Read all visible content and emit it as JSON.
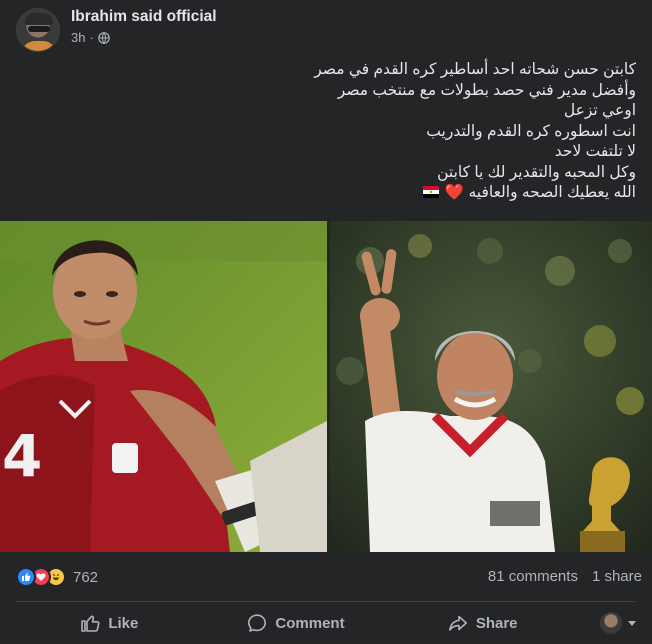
{
  "post": {
    "author": "Ibrahim said official",
    "time": "3h",
    "separator": "·",
    "privacy_icon": "globe-icon",
    "text_lines": [
      "كابتن حسن شحاته احد أساطير كره القدم في مصر",
      "وأفضل مدير فني حصد بطولات مع منتخب مصر",
      "اوعي تزعل",
      "انت اسطوره كره القدم والتدريب",
      "لا تلتفت لاحد",
      "وكل المحبه والتقدير لك يا كابتن",
      "الله يعطيك الصحه والعافيه"
    ],
    "last_line_emojis": "❤️",
    "images": {
      "left": "player-in-red-jersey-photo",
      "right": "coach-victory-sign-photo"
    }
  },
  "reactions": {
    "icons": [
      "like-reaction-icon",
      "love-reaction-icon",
      "haha-reaction-icon"
    ],
    "count": "762",
    "comments": "81 comments",
    "shares": "1 share"
  },
  "actions": {
    "like": "Like",
    "comment": "Comment",
    "share": "Share"
  },
  "colors": {
    "background": "#242526",
    "text": "#e4e6eb",
    "secondary": "#b0b3b8",
    "like_blue": "#2d88ff",
    "love_red": "#f33e58",
    "haha_yellow": "#f7c948"
  }
}
